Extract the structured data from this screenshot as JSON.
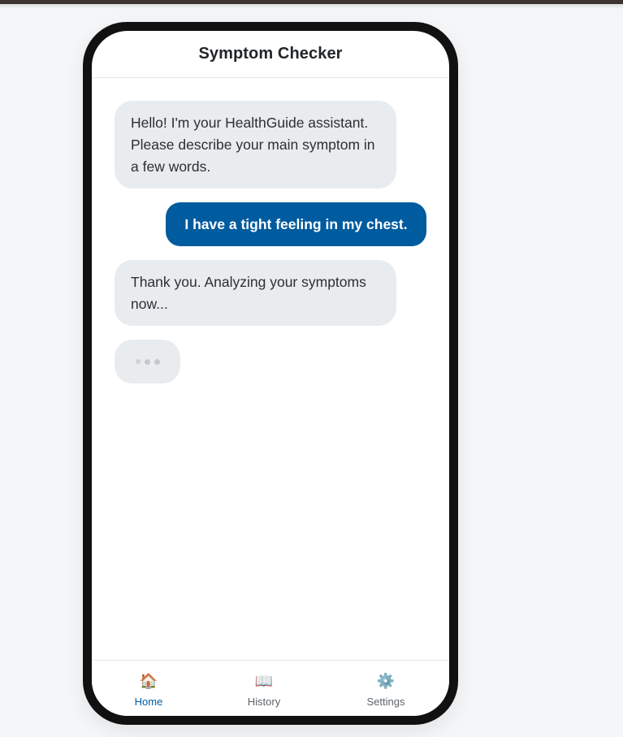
{
  "header": {
    "title": "Symptom Checker"
  },
  "messages": [
    {
      "sender": "bot",
      "text": "Hello! I'm your HealthGuide assistant. Please describe your main symptom in a few words."
    },
    {
      "sender": "user",
      "text": "I have a tight feeling in my chest."
    },
    {
      "sender": "bot",
      "text": "Thank you. Analyzing your symptoms now..."
    }
  ],
  "typing_indicator": {
    "visible": true
  },
  "nav": {
    "active": "home",
    "items": [
      {
        "id": "home",
        "label": "Home",
        "icon": "🏠"
      },
      {
        "id": "history",
        "label": "History",
        "icon": "📖"
      },
      {
        "id": "settings",
        "label": "Settings",
        "icon": "⚙️"
      }
    ]
  },
  "colors": {
    "accent": "#005b9f",
    "bot_bubble": "#e9ecef",
    "background": "#f4f6f8"
  }
}
